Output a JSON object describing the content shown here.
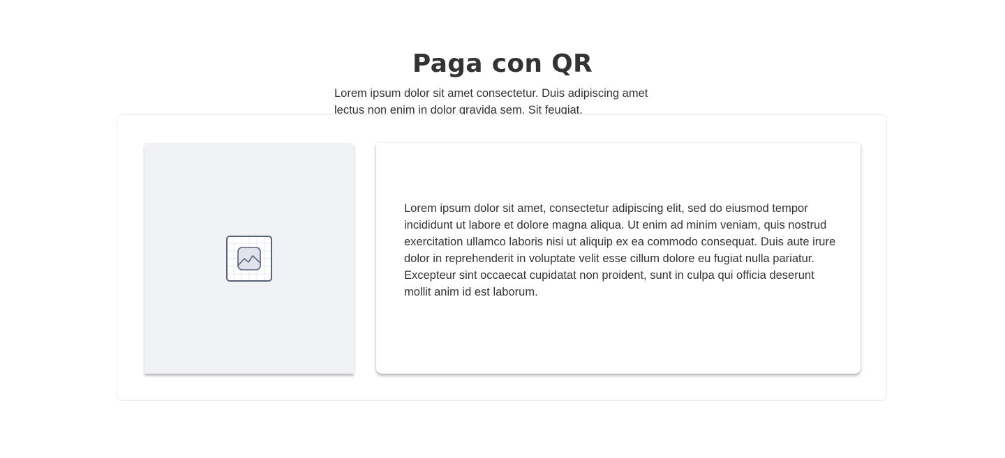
{
  "header": {
    "title": "Paga con QR",
    "subtitle": "Lorem ipsum dolor sit amet consectetur. Duis adipiscing amet lectus non enim in dolor gravida sem. Sit feugiat."
  },
  "media": {
    "icon": "image-placeholder-icon"
  },
  "content": {
    "body": "Lorem ipsum dolor sit amet, consectetur adipiscing elit, sed do eiusmod tempor incididunt ut labore et dolore magna aliqua. Ut enim ad minim veniam, quis nostrud exercitation ullamco laboris nisi ut aliquip ex ea commodo consequat. Duis aute irure dolor in reprehenderit in voluptate velit esse cillum dolore eu fugiat nulla pariatur. Excepteur sint occaecat cupidatat non proident, sunt in culpa qui officia deserunt mollit anim id est laborum."
  },
  "colors": {
    "text": "#333333",
    "placeholder_bg": "#f1f2f6",
    "icon_stroke": "#5a6178",
    "border": "#ececec"
  }
}
